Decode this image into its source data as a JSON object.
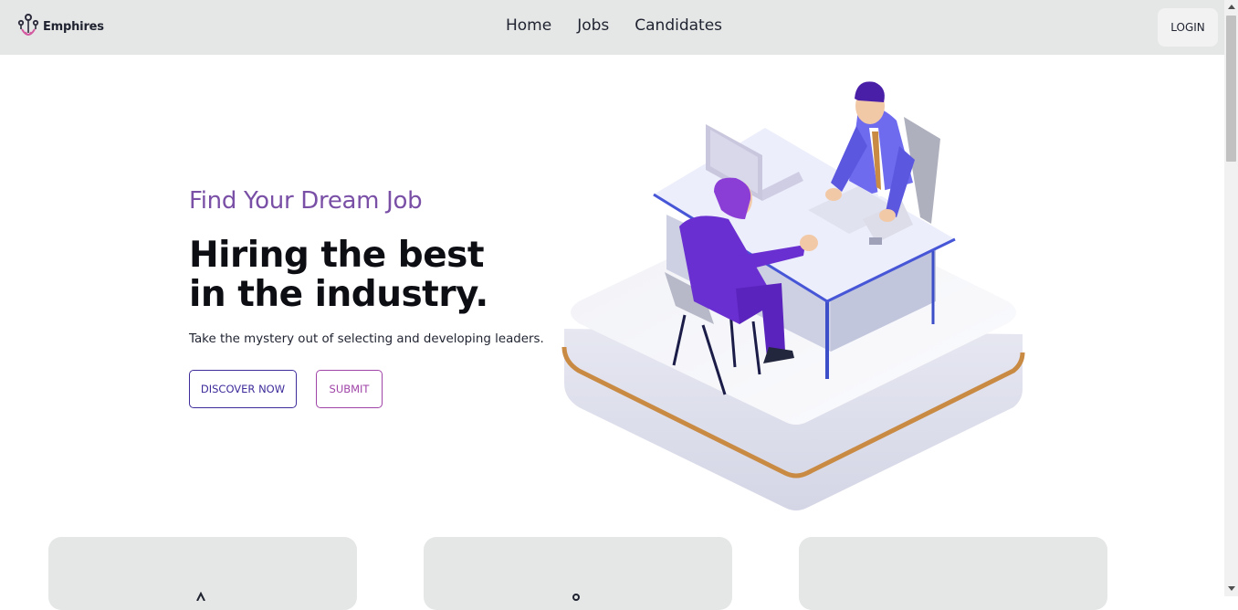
{
  "nav": {
    "brand": "Emphires",
    "links": [
      "Home",
      "Jobs",
      "Candidates"
    ],
    "login": "LOGIN"
  },
  "hero": {
    "subtitle": "Find Your Dream Job",
    "title_line1": "Hiring the best",
    "title_line2": "in the industry.",
    "description": "Take the mystery out of selecting and developing leaders.",
    "discover": "DISCOVER NOW",
    "submit": "SUBMIT"
  },
  "colors": {
    "accent_purple": "#7a4fa6",
    "primary_indigo": "#3f2c9b",
    "secondary_magenta": "#a044a8",
    "nav_bg": "#e5e6e6"
  }
}
